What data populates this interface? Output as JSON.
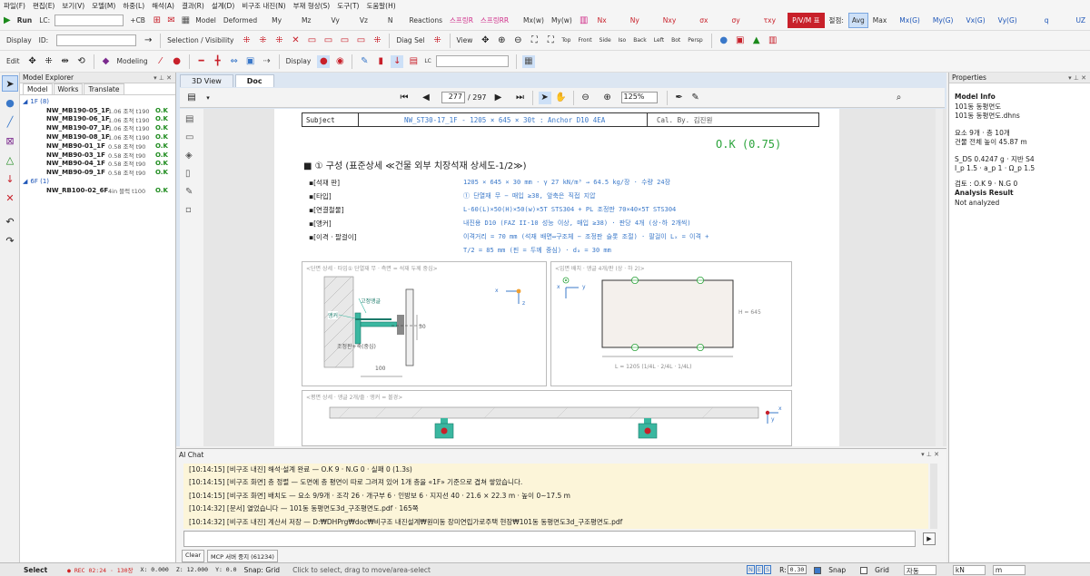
{
  "menu": [
    "파일(F)",
    "편집(E)",
    "보기(V)",
    "모델(M)",
    "하중(L)",
    "해석(A)",
    "결과(R)",
    "설계(D)",
    "비구조 내진(N)",
    "부재 형상(S)",
    "도구(T)",
    "도움말(H)"
  ],
  "toolbar1": {
    "run": "Run",
    "lc_label": "LC:",
    "add_cb": "+CB",
    "results": [
      "Model",
      "Deformed",
      "My",
      "Mz",
      "Vy",
      "Vz",
      "N",
      "Reactions"
    ],
    "spring_r": "스프링R",
    "spring_rr": "스프링RR",
    "moment": [
      "Mx(w)",
      "My(w)"
    ],
    "stress": [
      "Nx",
      "Ny",
      "Nxy",
      "σx",
      "σy",
      "τxy"
    ],
    "pvm": "P/V/M 표",
    "smooth_label": "절점:",
    "avg": "Avg",
    "max": "Max",
    "global": [
      "Mx(G)",
      "My(G)",
      "Vx(G)",
      "Vy(G)",
      "q",
      "UZ"
    ]
  },
  "toolbar2": {
    "display": "Display",
    "id_label": "ID:",
    "selection": "Selection / Visibility",
    "diag_sel": "Diag Sel",
    "view": "View",
    "views": [
      "Top",
      "Front",
      "Side",
      "Iso",
      "Back",
      "Left",
      "Bot",
      "Persp"
    ]
  },
  "toolbar3": {
    "edit": "Edit",
    "modeling": "Modeling",
    "display": "Display",
    "lc_label": "LC"
  },
  "explorer": {
    "title": "Model Explorer",
    "tabs": [
      "Model",
      "Works",
      "Translate"
    ],
    "groups": [
      {
        "label": "1F  (8)",
        "items": [
          {
            "name": "NW_MB190-05_1F",
            "desc": "1.06 조적 t190",
            "status": "O.K"
          },
          {
            "name": "NW_MB190-06_1F",
            "desc": "1.06 조적 t190",
            "status": "O.K"
          },
          {
            "name": "NW_MB190-07_1F",
            "desc": "1.06 조적 t190",
            "status": "O.K"
          },
          {
            "name": "NW_MB190-08_1F",
            "desc": "1.06 조적 t190",
            "status": "O.K"
          },
          {
            "name": "NW_MB90-01_1F",
            "desc": "0.58 조적 t90",
            "status": "O.K"
          },
          {
            "name": "NW_MB90-03_1F",
            "desc": "0.58 조적 t90",
            "status": "O.K"
          },
          {
            "name": "NW_MB90-04_1F",
            "desc": "0.58 조적 t90",
            "status": "O.K"
          },
          {
            "name": "NW_MB90-09_1F",
            "desc": "0.58 조적 t90",
            "status": "O.K"
          }
        ]
      },
      {
        "label": "6F  (1)",
        "items": [
          {
            "name": "NW_RB100-02_6F",
            "desc": "4in 블럭 t100",
            "status": "O.K"
          }
        ]
      }
    ]
  },
  "center": {
    "tabs": [
      "3D View",
      "Doc"
    ],
    "page_current": "277",
    "page_total": "/ 297",
    "zoom": "125%"
  },
  "doc": {
    "subject_label": "Subject",
    "subject_value": "NW_ST30-17_1F - 1205 × 645 × 30t : Anchor D10 4EA",
    "cal_by": "Cal. By.   김진원",
    "ok": "O.K (0.75)",
    "section_title": "■ ① 구성 (표준상세 ≪건물 외부 치장석재 상세도-1/2≫)",
    "specs": [
      {
        "k": "▪[석재 판]",
        "v": "1205 × 645 × 30 mm · γ 27 kN/m³ → 64.5 kg/장 · 수량 24장"
      },
      {
        "k": "▪[타입]",
        "v": "① 단열재 무 − 매입 ≥38, 앞축은 직접 지압"
      },
      {
        "k": "▪[연결철물]",
        "v": "L-60(L)×50(H)×50(w)×5T STS304 + PL 조정판 70×40×5T STS304"
      },
      {
        "k": "▪[앵커]",
        "v": "내진용 D10 (FAZ II-10 성능 이상, 매입 ≥38) · 판당 4개 (상·하 2개씩)"
      },
      {
        "k": "▪[이격 · 팔걸이]",
        "v": "이격거리 = 70 mm (석재 배면↔구조체 − 조정판 슬롯 조절) · 팔걸이 Lₓ = 이격 +"
      },
      {
        "k": "",
        "v": "T/2 = 85 mm (핀 = 두께 중심) · dₐ = 30 mm"
      }
    ],
    "fig1": {
      "caption": "<단면 상세 · 타입① 단열재 무 · 측면 = 석재 두께 중심>",
      "label_anchor": "앵커",
      "label_angle": "고정앵글",
      "label_plate": "조정판+축(중심)",
      "dim_30": "30",
      "dim_100": "100"
    },
    "fig2": {
      "caption": "<입면 배치 · 앵글 4개/판 (상 · 하 2)>",
      "h_label": "H = 645",
      "l_label": "L = 1205  (1/4L · 2/4L · 1/4L)"
    },
    "fig3": {
      "caption": "<평면 상세 · 앵글 2개/줄 · 앵커 = 볼경>"
    }
  },
  "chat": {
    "title": "AI Chat",
    "lines": [
      "[10:14:15] [비구조 내진] 해석·설계 완료 — O.K 9 · N.G 0 · 실패 0 (1.3s)",
      "[10:14:15] [비구조 화면] 층 정렬 — 도면에 층 평면이 따로 그려져 있어 1개 층을 «1F» 기준으로 겹쳐 쌓았습니다.",
      "[10:14:15] [비구조 화면] 배치도 — 요소 9/9개 · 조각 26 · 개구부 6 · 인방보 6 · 지지선 40 · 21.6 × 22.3 m · 높이 0~17.5 m",
      "[10:14:32] [문서] 열었습니다 — 101동 동평면도3d_구조평면도.pdf · 165쪽",
      "[10:14:32] [비구조 내진] 계산서 저장 — D:₩DHPrg₩doc₩비구조 내진설계₩원미동 장미연립가로주택 현장₩101동 동평면도3d_구조평면도.pdf"
    ],
    "clear": "Clear",
    "mcp": "MCP 서버 중지 (61234)"
  },
  "properties": {
    "title": "Properties",
    "model_info_head": "Model Info",
    "model_name": "101동 동평면도",
    "file": "101동 동평면도.dhns",
    "elements": "요소 9개 · 층 10개",
    "height": "건물 전체 높이 45.87 m",
    "sds": "S_DS 0.4247 g · 지반 S4",
    "ip": "I_p 1.5 · a_p 1 · Ω_p 1.5",
    "check": "검토 : O.K 9 · N.G 0",
    "analysis_head": "Analysis Result",
    "analysis_value": "Not analyzed"
  },
  "status": {
    "mode": "Select",
    "rec": "● REC 02:24 · 130장",
    "x": "X: 0.000",
    "z": "Z: 12.000",
    "y": "Y: 0.0",
    "snap_grid": "Snap: Grid",
    "hint": "Click to select, drag to move/area-select",
    "nes": [
      "N",
      "E",
      "S"
    ],
    "r_label": "R:",
    "r_value": "0.30",
    "snap": "Snap",
    "grid": "Grid",
    "auto": "자동",
    "unit1": "kN",
    "unit2": "m"
  },
  "colors": {
    "accent": "#1e56b8",
    "ok": "#1b8a1b",
    "doc_blue": "#3a78c9",
    "red": "#c8202a",
    "chat_bg": "#fcf5d9"
  }
}
